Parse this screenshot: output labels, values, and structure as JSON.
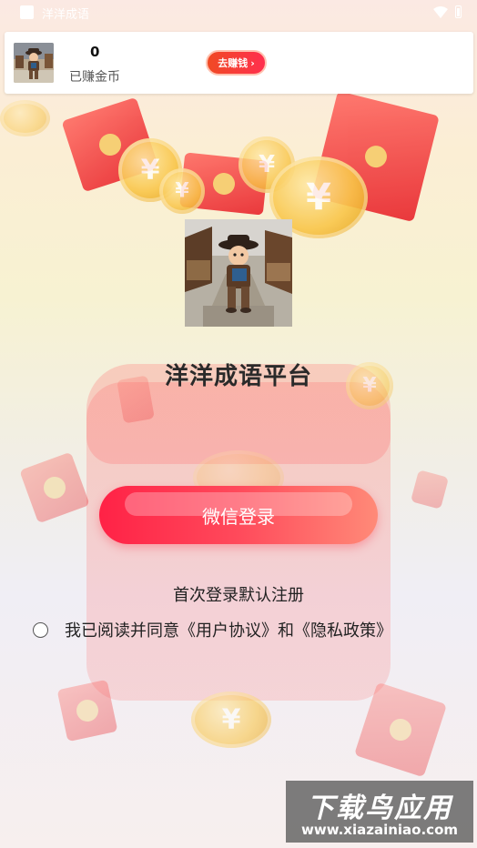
{
  "status_bar": {
    "app_title": "洋洋成语"
  },
  "earnings_card": {
    "coins_value": "0",
    "coins_label": "已赚金币",
    "earn_button_label": "去赚钱",
    "earn_button_arrow": "›"
  },
  "app": {
    "name": "洋洋成语平台"
  },
  "login": {
    "button_label": "微信登录",
    "register_hint": "首次登录默认注册",
    "agreement_text": "我已阅读并同意《用户协议》和《隐私政策》",
    "agreement_checked": false
  },
  "watermark": {
    "title": "下载鸟应用",
    "url": "www.xiazainiao.com"
  },
  "colors": {
    "accent": "#ff2f4e",
    "button_gradient_start": "#ff2246",
    "button_gradient_end": "#ff8a78"
  },
  "decor": {
    "coin_symbol": "¥"
  }
}
